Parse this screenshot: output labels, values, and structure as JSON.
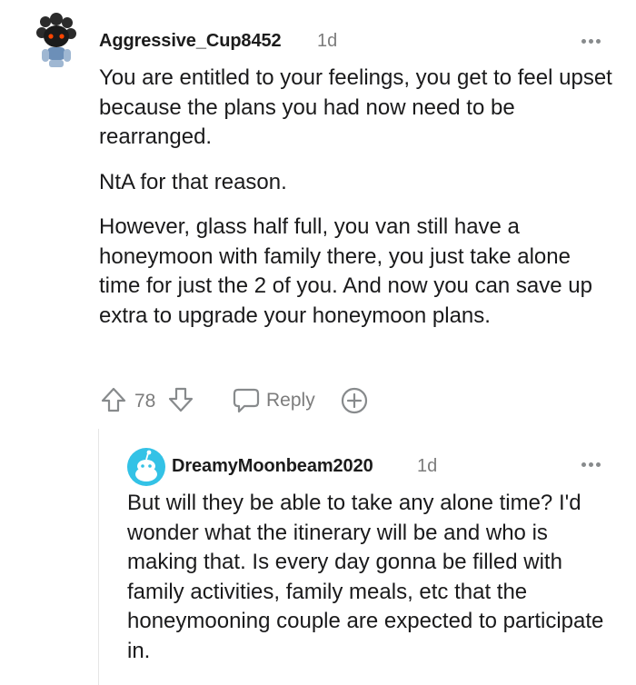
{
  "comment": {
    "username": "Aggressive_Cup8452",
    "age": "1d",
    "paragraphs": [
      "You are entitled to your feelings, you get to feel upset because the plans you had now need to be rearranged.",
      "NtA for that reason.",
      "However, glass half full, you van still have a honeymoon with family there, you just take alone time for just the 2 of you. And now you can save up extra to upgrade your honeymoon plans."
    ],
    "votes": "78",
    "reply_label": "Reply"
  },
  "reply": {
    "username": "DreamyMoonbeam2020",
    "age": "1d",
    "text": "But will they be able to take any alone time? I'd wonder what the itinerary will be and who is making that. Is every day gonna be filled with family activities, family meals, etc that the honeymooning couple are expected to participate in."
  },
  "icons": {
    "upvote": "arrow-up-icon",
    "downvote": "arrow-down-icon",
    "reply": "speech-bubble-icon",
    "award": "plus-circle-icon",
    "more": "ellipsis-icon"
  },
  "colors": {
    "username": "#1c1c1c",
    "meta": "#7c7c7c",
    "reply_avatar": "#33c2e6"
  }
}
